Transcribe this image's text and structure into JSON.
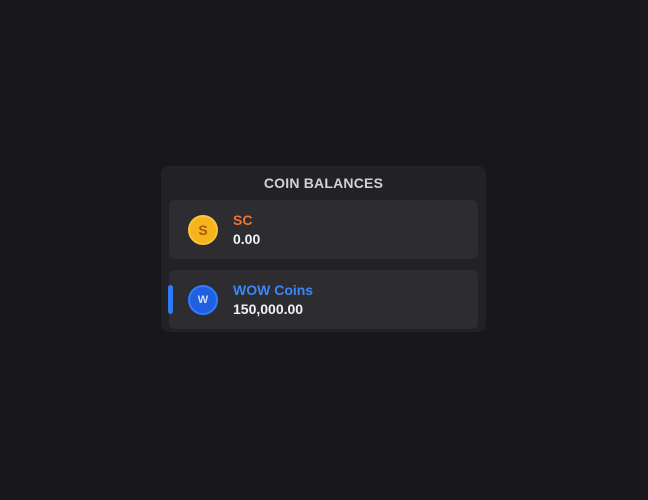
{
  "panel": {
    "title": "COIN BALANCES"
  },
  "coins": [
    {
      "name": "SC",
      "amount": "0.00",
      "icon_letter": "S",
      "icon": "sc-coin-icon",
      "name_color": "#f0742a",
      "selected": false
    },
    {
      "name": "WOW Coins",
      "amount": "150,000.00",
      "icon_letter": "W",
      "icon": "wow-coin-icon",
      "name_color": "#3d86f6",
      "selected": true
    }
  ],
  "colors": {
    "background": "#18181c",
    "panel": "#222226",
    "row": "#2c2c31",
    "accent": "#2d7cf6"
  }
}
